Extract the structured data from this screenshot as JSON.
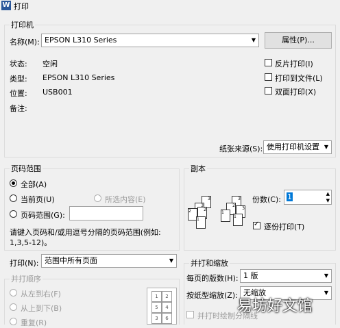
{
  "window": {
    "title": "打印",
    "icon": "word-icon"
  },
  "printer": {
    "group_label": "打印机",
    "name_label": "名称(M):",
    "name_value": "EPSON L310 Series",
    "properties_button": "属性(P)...",
    "status_label": "状态:",
    "status_value": "空闲",
    "type_label": "类型:",
    "type_value": "EPSON L310 Series",
    "location_label": "位置:",
    "location_value": "USB001",
    "comment_label": "备注:",
    "reverse_print": "反片打印(I)",
    "print_to_file": "打印到文件(L)",
    "duplex_print": "双面打印(X)",
    "paper_source_label": "纸张来源(S):",
    "paper_source_value": "使用打印机设置"
  },
  "page_range": {
    "group_label": "页码范围",
    "all": "全部(A)",
    "current_page": "当前页(U)",
    "selection": "所选内容(E)",
    "pages": "页码范围(G):",
    "pages_value": "",
    "hint": "请键入页码和/或用逗号分隔的页码范围(例如:",
    "hint_example": "1,3,5-12)。",
    "selected": "all"
  },
  "copies": {
    "group_label": "副本",
    "count_label": "份数(C):",
    "count_value": "1",
    "collate": "逐份打印(T)",
    "collate_checked": true
  },
  "print_what": {
    "label": "打印(N):",
    "value": "范围中所有页面"
  },
  "print_order": {
    "group_label": "并打顺序",
    "left_to_right": "从左到右(F)",
    "top_to_bottom": "从上到下(B)",
    "repeat": "重复(R)"
  },
  "zoom": {
    "group_label": "并打和缩放",
    "pages_per_sheet_label": "每页的版数(H):",
    "pages_per_sheet_value": "1 版",
    "scale_label": "按纸型缩放(Z):",
    "scale_value": "无缩放",
    "draw_borders": "并打时绘制分隔线"
  },
  "watermark": "易坊好文馆"
}
